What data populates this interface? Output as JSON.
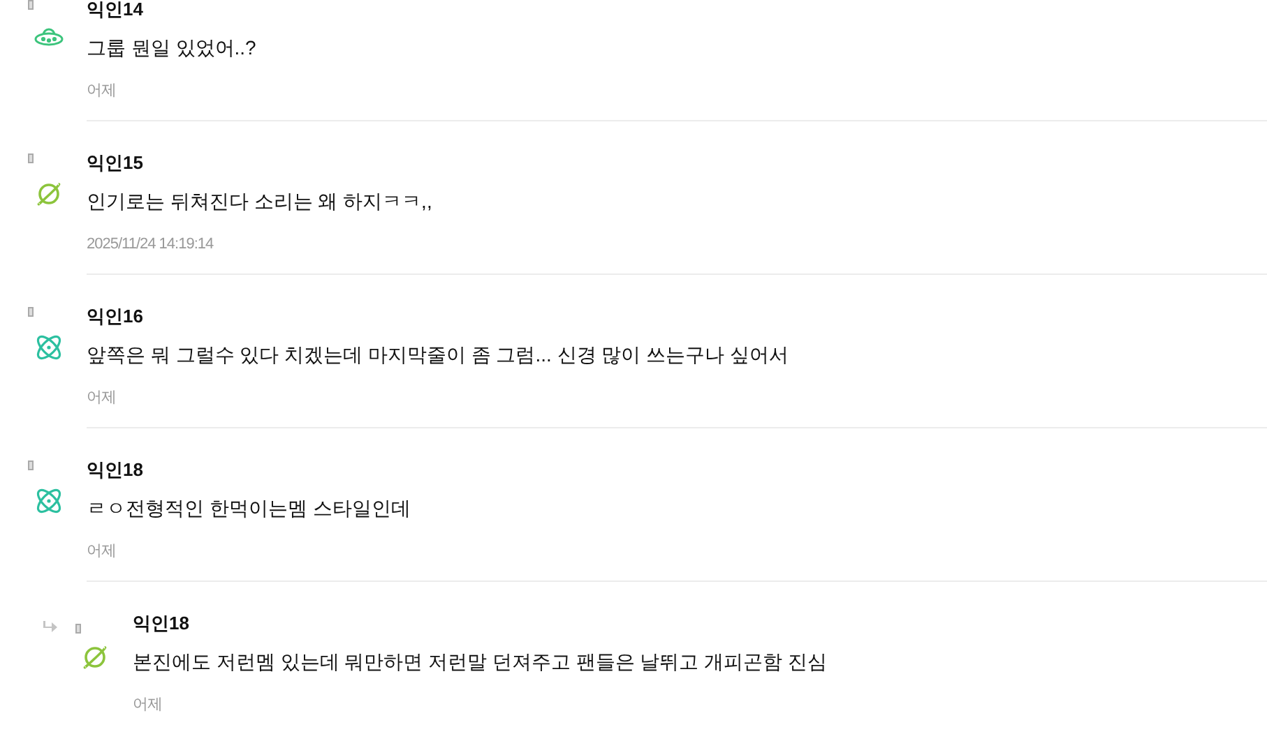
{
  "comments": [
    {
      "kind": "comment",
      "avatar": {
        "kind": "ufo"
      },
      "author": "익인14",
      "text": "그룹 뭔일 있었어..?",
      "time": "어제"
    },
    {
      "kind": "comment",
      "avatar": {
        "kind": "planet"
      },
      "author": "익인15",
      "text": "인기로는 뒤쳐진다 소리는 왜 하지ㅋㅋ,,",
      "time": "2025/11/24 14:19:14"
    },
    {
      "kind": "comment",
      "avatar": {
        "kind": "atom"
      },
      "author": "익인16",
      "text": "앞쪽은 뭐 그럴수 있다 치겠는데 마지막줄이 좀 그럼... 신경 많이 쓰는구나 싶어서",
      "time": "어제"
    },
    {
      "kind": "comment",
      "avatar": {
        "kind": "atom"
      },
      "author": "익인18",
      "text": "ㄹㅇ전형적인 한먹이는멤 스타일인데",
      "time": "어제"
    },
    {
      "kind": "reply",
      "avatar": {
        "kind": "planet"
      },
      "author": "익인18",
      "text": "본진에도 저런멤 있는데 뭐만하면 저런말 던져주고 팬들은 날뛰고 개피곤함 진심",
      "time": "어제"
    }
  ]
}
